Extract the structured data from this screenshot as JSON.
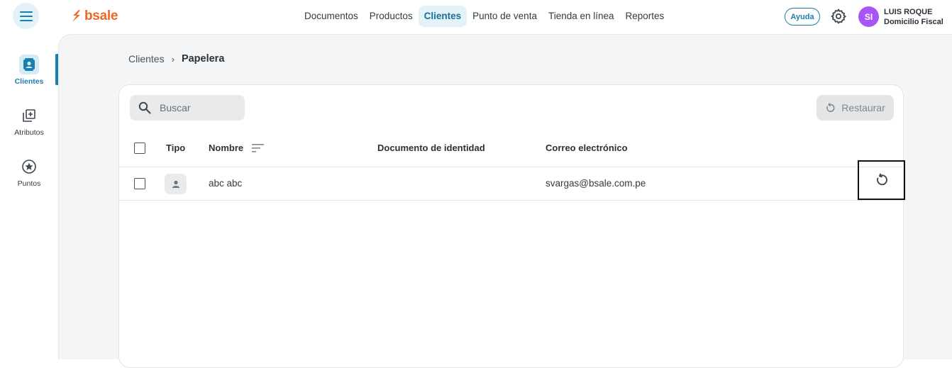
{
  "brand": {
    "name": "bsale",
    "color": "#f26522",
    "accent": "#1a7fab"
  },
  "header": {
    "menu_icon": "hamburger-icon",
    "nav": [
      {
        "label": "Documentos",
        "active": false
      },
      {
        "label": "Productos",
        "active": false
      },
      {
        "label": "Clientes",
        "active": true
      },
      {
        "label": "Punto de venta",
        "active": false
      },
      {
        "label": "Tienda en línea",
        "active": false
      },
      {
        "label": "Reportes",
        "active": false
      }
    ],
    "help_label": "Ayuda",
    "settings_icon": "gear-icon",
    "user": {
      "initials": "SI",
      "name": "LUIS ROQUE",
      "branch": "Domicilio Fiscal",
      "avatar_color": "#a855f7"
    }
  },
  "sidebar": {
    "items": [
      {
        "label": "Clientes",
        "icon": "contacts-icon",
        "active": true
      },
      {
        "label": "Atributos",
        "icon": "add-library-icon",
        "active": false
      },
      {
        "label": "Puntos",
        "icon": "star-circle-icon",
        "active": false
      }
    ]
  },
  "breadcrumb": {
    "parent": "Clientes",
    "separator": "›",
    "current": "Papelera"
  },
  "toolbar": {
    "search_placeholder": "Buscar",
    "search_value": "",
    "restore_label": "Restaurar",
    "restore_enabled": false
  },
  "table": {
    "columns": [
      "Tipo",
      "Nombre",
      "Documento de identidad",
      "Correo electrónico"
    ],
    "rows": [
      {
        "type": "person-icon",
        "name": "abc abc",
        "document": "",
        "email": "svargas@bsale.com.pe",
        "checked": false
      }
    ]
  }
}
